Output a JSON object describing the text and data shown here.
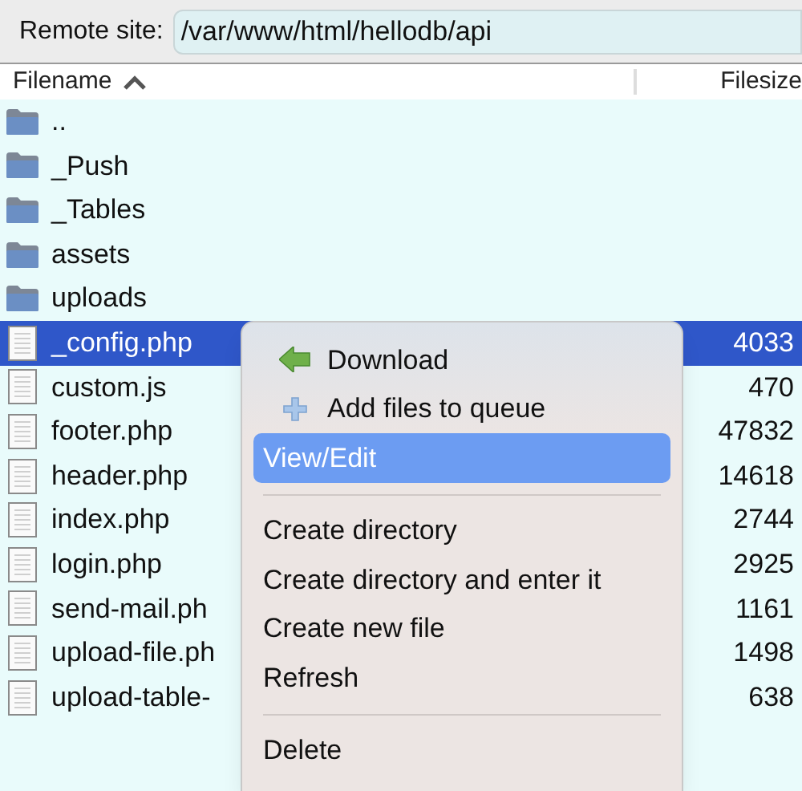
{
  "remote_site": {
    "label": "Remote site:",
    "value": "/var/www/html/hellodb/api"
  },
  "table": {
    "columns": [
      {
        "label": "Filename",
        "sorted": true
      },
      {
        "label": "Filesize",
        "sorted": false
      }
    ],
    "rows": [
      {
        "kind": "folder",
        "name": "..",
        "size": "",
        "selected": false
      },
      {
        "kind": "folder",
        "name": "_Push",
        "size": "",
        "selected": false
      },
      {
        "kind": "folder",
        "name": "_Tables",
        "size": "",
        "selected": false
      },
      {
        "kind": "folder",
        "name": "assets",
        "size": "",
        "selected": false
      },
      {
        "kind": "folder",
        "name": "uploads",
        "size": "",
        "selected": false
      },
      {
        "kind": "file",
        "name": "_config.php",
        "size": "4033",
        "selected": true
      },
      {
        "kind": "file",
        "name": "custom.js",
        "size": "470",
        "selected": false
      },
      {
        "kind": "file",
        "name": "footer.php",
        "size": "47832",
        "selected": false
      },
      {
        "kind": "file",
        "name": "header.php",
        "size": "14618",
        "selected": false
      },
      {
        "kind": "file",
        "name": "index.php",
        "size": "2744",
        "selected": false
      },
      {
        "kind": "file",
        "name": "login.php",
        "size": "2925",
        "selected": false
      },
      {
        "kind": "file",
        "name": "send-mail.ph",
        "size": "1161",
        "selected": false
      },
      {
        "kind": "file",
        "name": "upload-file.ph",
        "size": "1498",
        "selected": false
      },
      {
        "kind": "file",
        "name": "upload-table-",
        "size": "638",
        "selected": false
      }
    ]
  },
  "context_menu": {
    "items": [
      {
        "kind": "download",
        "label": "Download",
        "selected": false
      },
      {
        "kind": "enqueue",
        "label": "Add files to queue",
        "selected": false
      },
      {
        "kind": "item",
        "label": "View/Edit",
        "selected": true
      },
      {
        "kind": "separator"
      },
      {
        "kind": "item",
        "label": "Create directory",
        "selected": false
      },
      {
        "kind": "item",
        "label": "Create directory and enter it",
        "selected": false
      },
      {
        "kind": "item",
        "label": "Create new file",
        "selected": false
      },
      {
        "kind": "item",
        "label": "Refresh",
        "selected": false
      },
      {
        "kind": "separator"
      },
      {
        "kind": "item",
        "label": "Delete",
        "selected": false
      }
    ]
  }
}
